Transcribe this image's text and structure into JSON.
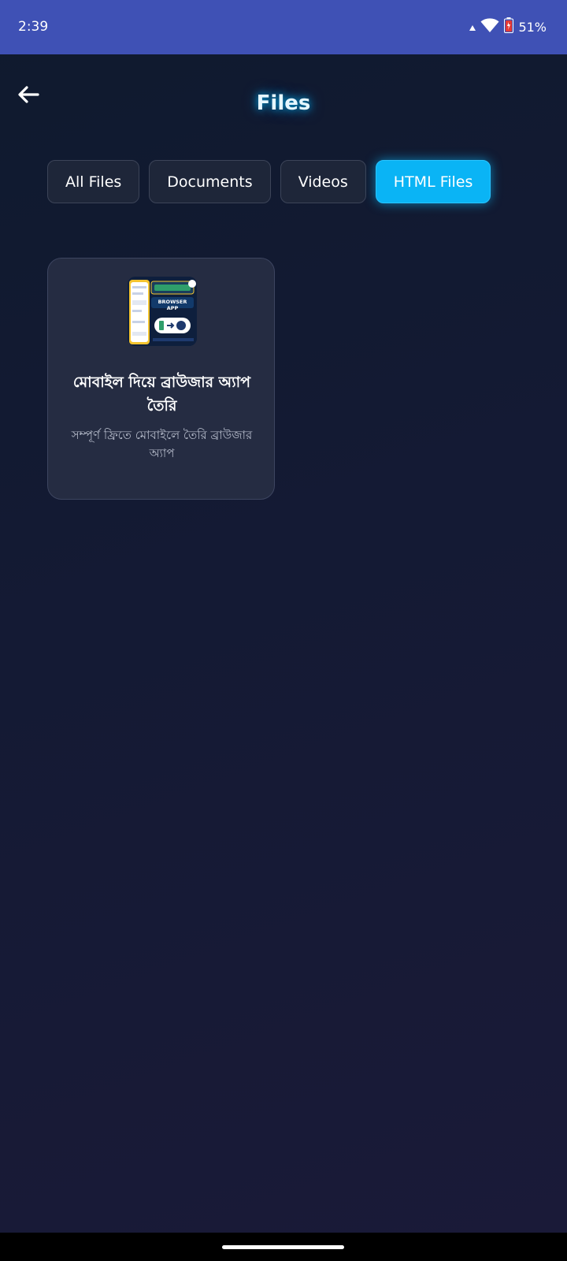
{
  "status_bar": {
    "time": "2:39",
    "battery": "51%",
    "icons": [
      "signal-icon",
      "wifi-icon",
      "battery-icon"
    ]
  },
  "header": {
    "title": "Files",
    "back_icon": "arrow-left-icon"
  },
  "tabs": [
    {
      "label": "All Files",
      "active": false
    },
    {
      "label": "Documents",
      "active": false
    },
    {
      "label": "Videos",
      "active": false
    },
    {
      "label": "HTML Files",
      "active": true
    }
  ],
  "files": [
    {
      "thumbnail_text": "BROWSER APP",
      "title": "মোবাইল দিয়ে ব্রাউজার অ্যাপ তৈরি",
      "description": "সম্পূর্ণ ফ্রিতে মোবাইলে তৈরি ব্রাউজার অ্যাপ"
    }
  ],
  "colors": {
    "status_bar": "#3f51b5",
    "accent": "#0ab4f5",
    "background": "#141a34",
    "card": "#252c42"
  }
}
